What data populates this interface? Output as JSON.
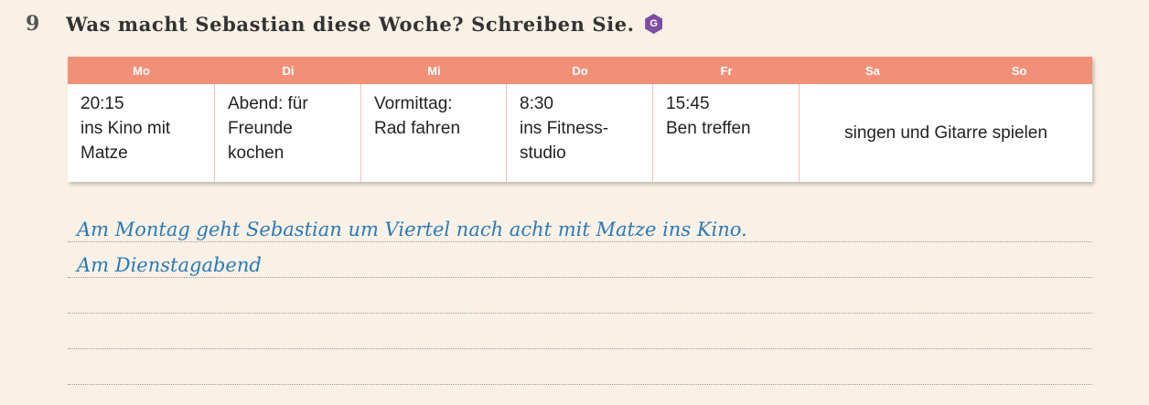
{
  "exercise": {
    "number": "9",
    "title": "Was macht Sebastian diese Woche? Schreiben Sie.",
    "badge": "G"
  },
  "schedule": {
    "days": [
      "Mo",
      "Di",
      "Mi",
      "Do",
      "Fr",
      "Sa",
      "So"
    ],
    "entries": [
      [
        "20:15",
        "ins Kino mit",
        "Matze"
      ],
      [
        "Abend: für",
        "Freunde",
        "kochen"
      ],
      [
        "Vormittag:",
        "Rad fahren"
      ],
      [
        "8:30",
        "ins Fitness-",
        "studio"
      ],
      [
        "15:45",
        "Ben treffen"
      ]
    ],
    "weekend": "singen und Gitarre spielen"
  },
  "answers": {
    "line1": "Am Montag geht Sebastian um Viertel nach acht mit Matze ins Kino.",
    "line2": "Am Dienstagabend",
    "line3": "",
    "line4": "",
    "line5": ""
  },
  "colors": {
    "header_bar": "#f09077",
    "badge": "#7c4ea3",
    "handwriting": "#2a7ab5",
    "page_background": "#faf1e6"
  }
}
